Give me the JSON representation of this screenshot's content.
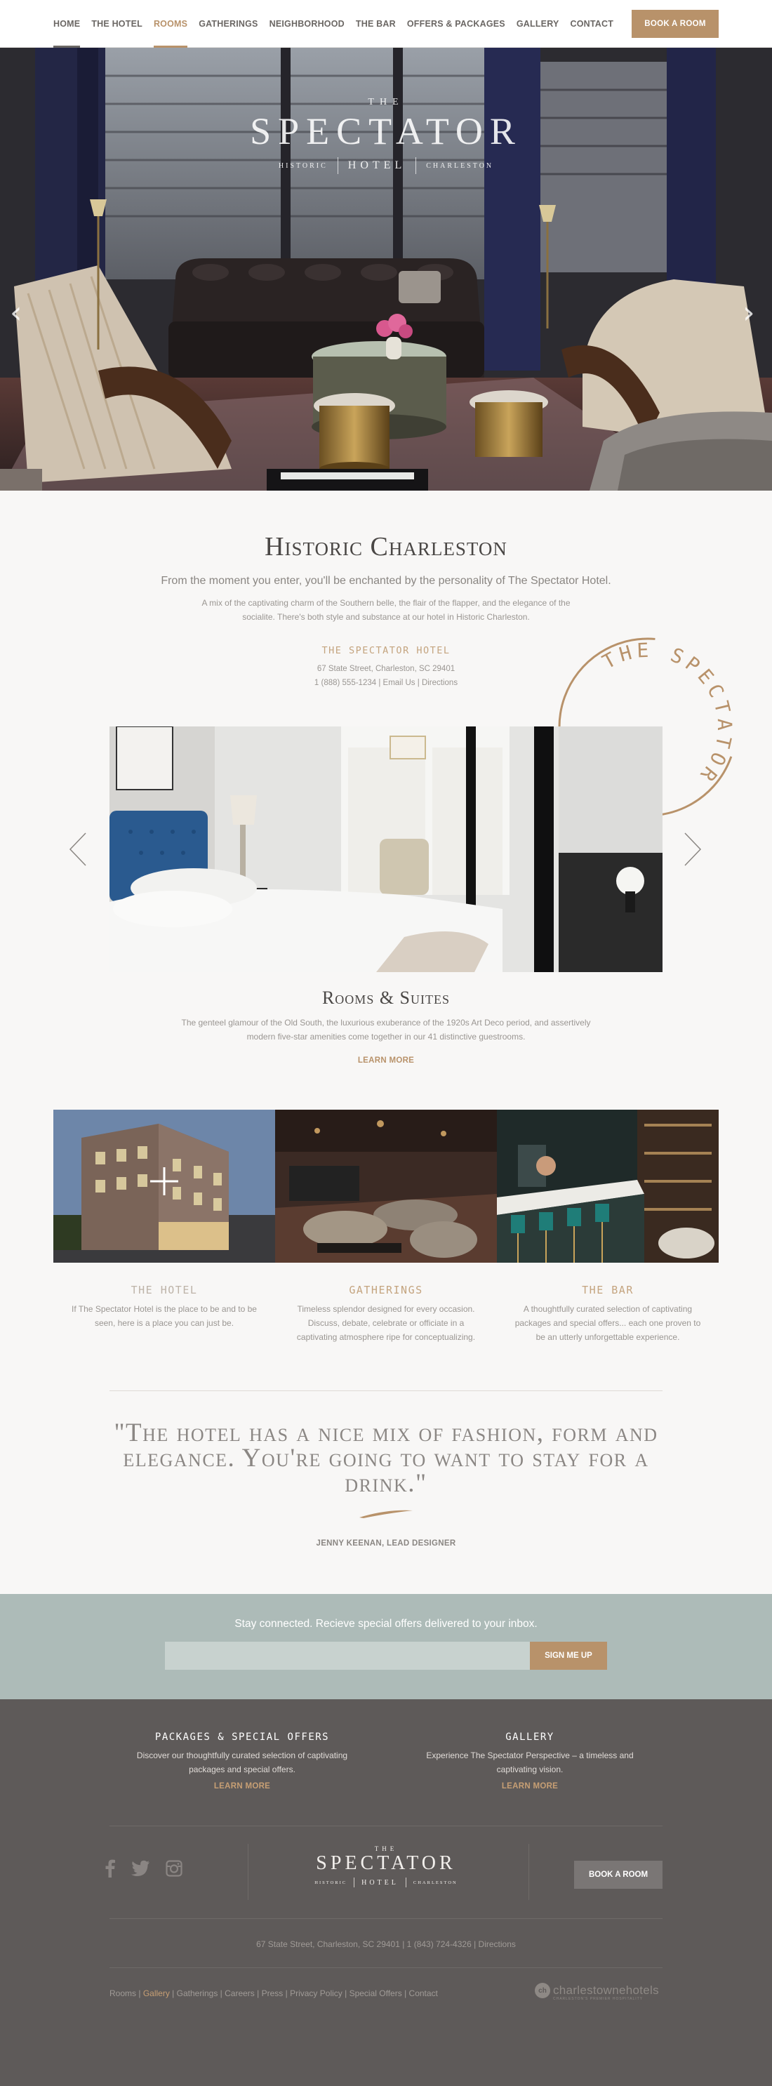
{
  "nav": {
    "items": [
      {
        "label": "HOME",
        "state": "underline-gray"
      },
      {
        "label": "THE HOTEL",
        "state": "plain"
      },
      {
        "label": "ROOMS",
        "state": "active"
      },
      {
        "label": "GATHERINGS",
        "state": "plain"
      },
      {
        "label": "NEIGHBORHOOD",
        "state": "plain"
      },
      {
        "label": "THE BAR",
        "state": "plain"
      },
      {
        "label": "OFFERS & PACKAGES",
        "state": "plain"
      },
      {
        "label": "GALLERY",
        "state": "plain"
      },
      {
        "label": "CONTACT",
        "state": "plain"
      }
    ],
    "book_label": "BOOK A ROOM"
  },
  "hero": {
    "logo_the": "THE",
    "logo_name": "SPECTATOR",
    "logo_left": "HISTORIC",
    "logo_mid": "HOTEL",
    "logo_right": "CHARLESTON",
    "prev_icon": "chevron-left-icon",
    "next_icon": "chevron-right-icon"
  },
  "intro": {
    "title": "Historic Charleston",
    "lead": "From the moment you enter, you'll be enchanted by the personality of The Spectator Hotel.",
    "desc": "A mix of the captivating charm of the Southern belle, the flair of the flapper, and the elegance of the socialite. There's both style and substance at our hotel in Historic Charleston.",
    "hotel_name": "THE SPECTATOR HOTEL",
    "address": "67 State Street, Charleston, SC 29401",
    "phone": "1 (888) 555-1234",
    "email_label": "Email Us",
    "directions_label": "Directions",
    "stamp_text": "THE SPECTATOR HOTEL"
  },
  "rooms": {
    "title": "Rooms & Suites",
    "desc": "The genteel glamour of the Old South, the luxurious exuberance of the 1920s Art Deco period, and assertively modern five-star amenities come together in our 41 distinctive guestrooms.",
    "learn_more": "LEARN MORE"
  },
  "features": [
    {
      "label": "THE HOTEL",
      "text": "If The Spectator Hotel is the place to be and to be seen, here is a place you can just be."
    },
    {
      "label": "GATHERINGS",
      "text": "Timeless splendor designed for every occasion. Discuss, debate, celebrate or officiate in a captivating atmosphere ripe for conceptualizing."
    },
    {
      "label": "THE BAR",
      "text": "A thoughtfully curated selection of captivating packages and special offers... each one proven to be an utterly unforgettable experience."
    }
  ],
  "quote": {
    "text": "\"The hotel has a nice mix of fashion, form and elegance. You're going to want to stay for a drink.\"",
    "author": "JENNY KEENAN, LEAD DESIGNER"
  },
  "newsletter": {
    "message": "Stay connected. Recieve special offers delivered to your inbox.",
    "placeholder": "",
    "button": "SIGN ME UP"
  },
  "footer": {
    "packages_title": "PACKAGES & SPECIAL OFFERS",
    "packages_text": "Discover our thoughtfully curated selection of captivating packages and special offers.",
    "packages_link": "LEARN MORE",
    "gallery_title": "GALLERY",
    "gallery_text": "Experience The Spectator Perspective – a timeless and captivating vision.",
    "gallery_link": "LEARN MORE",
    "social_icons": [
      "facebook-icon",
      "twitter-icon",
      "instagram-icon"
    ],
    "logo_the": "THE",
    "logo_name": "SPECTATOR",
    "logo_left": "HISTORIC",
    "logo_mid": "HOTEL",
    "logo_right": "CHARLESTON",
    "book_label": "BOOK A ROOM",
    "address_line": "67 State Street, Charleston, SC 29401 | 1 (843) 724-4326 | Directions",
    "links": [
      "Rooms",
      "Gallery",
      "Gatherings",
      "Careers",
      "Press",
      "Privacy Policy",
      "Special Offers",
      "Contact"
    ],
    "brand_mark": "ch",
    "brand_name": "charlestownehotels",
    "brand_tagline": "CHARLESTON'S PREMIER HOSPITALITY"
  },
  "colors": {
    "accent": "#b8926a",
    "newsletter_bg": "#adbbb8",
    "footer_bg": "#5e5a59"
  }
}
